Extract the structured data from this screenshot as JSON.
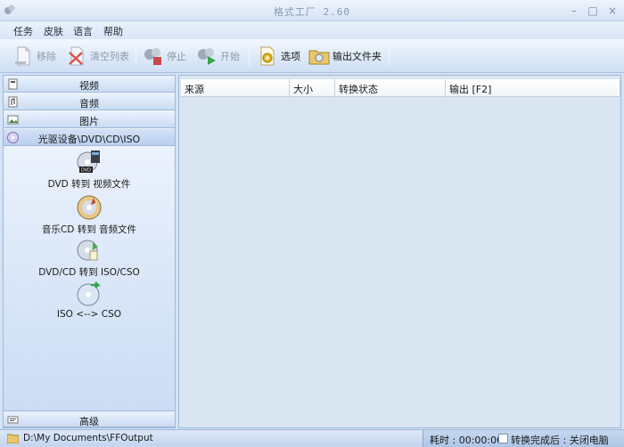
{
  "window": {
    "title": "格式工厂 2.60"
  },
  "menu": [
    "任务",
    "皮肤",
    "语言",
    "帮助"
  ],
  "toolbar": {
    "remove": "移除",
    "clear_list": "清空列表",
    "stop": "停止",
    "start": "开始",
    "options": "选项",
    "output_folder": "输出文件夹"
  },
  "sidebar": {
    "categories": [
      "视频",
      "音频",
      "图片",
      "光驱设备\\DVD\\CD\\ISO"
    ],
    "tools": [
      "DVD 转到 视频文件",
      "音乐CD 转到 音频文件",
      "DVD/CD 转到 ISO/CSO",
      "ISO <--> CSO"
    ],
    "advanced": "高级",
    "dvd_badge": "DVD"
  },
  "list": {
    "columns": [
      "来源",
      "大小",
      "转换状态",
      "输出 [F2]"
    ]
  },
  "status": {
    "output_path": "D:\\My Documents\\FFOutput",
    "elapsed": "耗时 : 00:00:00",
    "after_done": "转换完成后 : 关闭电脑"
  }
}
